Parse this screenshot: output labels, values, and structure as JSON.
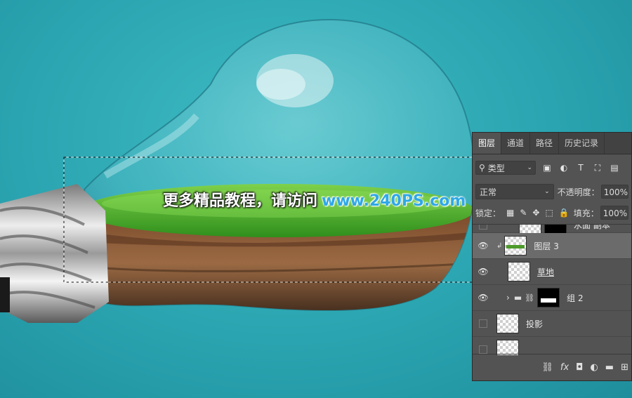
{
  "watermark": {
    "text_cn": "更多精品教程，请访问",
    "url": "www.240PS.com"
  },
  "panel": {
    "tabs": [
      "图层",
      "通道",
      "路径",
      "历史记录"
    ],
    "filter_label": "类型",
    "blend_mode": "正常",
    "opacity_label": "不透明度：",
    "opacity": "100%",
    "lock_label": "锁定：",
    "fill_label": "填充：",
    "fill": "100%",
    "layers": [
      {
        "name": "水面 副本",
        "visible": false
      },
      {
        "name": "图层 3",
        "visible": true,
        "selected": true
      },
      {
        "name": "草地",
        "visible": true
      },
      {
        "name": "组 2",
        "visible": true
      },
      {
        "name": "投影",
        "visible": false
      },
      {
        "name": "",
        "visible": false
      }
    ]
  },
  "colors": {
    "background": "#2aa4b0",
    "panel": "#535353",
    "url_blue": "#2fa8e6"
  }
}
